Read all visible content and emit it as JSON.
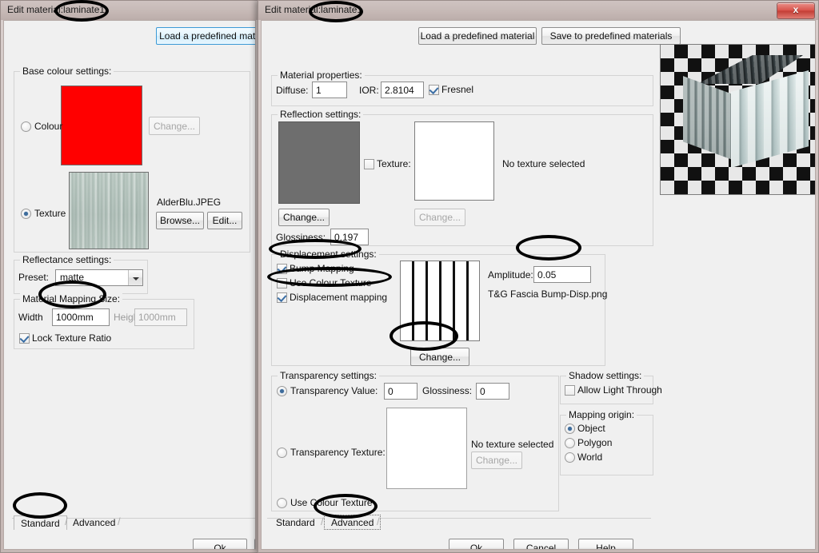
{
  "back_dialog": {
    "title_prefix": "Edit material:",
    "title_value": "laminate1",
    "load_button": "Load a predefined mate",
    "base_colour": {
      "group_title": "Base colour settings:",
      "colour_label": "Colour",
      "colour_swatch_hex": "#FF0000",
      "colour_change_button": "Change...",
      "texture_label": "Texture",
      "texture_filename": "AlderBlu.JPEG",
      "browse_button": "Browse...",
      "edit_button": "Edit..."
    },
    "reflectance": {
      "group_title": "Reflectance settings:",
      "preset_label": "Preset:",
      "preset_value": "matte"
    },
    "mapping": {
      "group_title": "Material Mapping Size:",
      "width_label": "Width",
      "width_value": "1000mm",
      "height_label": "Height",
      "height_value": "1000mm",
      "lock_label": "Lock Texture Ratio"
    },
    "tabs": {
      "standard": "Standard",
      "advanced": "Advanced"
    },
    "ok_button": "Ok"
  },
  "front_dialog": {
    "title_prefix": "Edit material:",
    "title_value": "laminate1",
    "close_glyph": "x",
    "load_button": "Load a predefined material",
    "save_button": "Save to predefined materials",
    "material_properties": {
      "group_title": "Material properties:",
      "diffuse_label": "Diffuse:",
      "diffuse_value": "1",
      "ior_label": "IOR:",
      "ior_value": "2.8104",
      "fresnel_label": "Fresnel"
    },
    "reflection": {
      "group_title": "Reflection settings:",
      "swatch_hex": "#6E6E6E",
      "change_button": "Change...",
      "texture_checkbox_label": "Texture:",
      "texture_change_button": "Change...",
      "no_texture_text": "No texture selected",
      "glossiness_label": "Glossiness:",
      "glossiness_value": "0.197"
    },
    "displacement": {
      "group_title": "Displacement settings:",
      "bump_mapping_label": "Bump Mapping",
      "use_colour_texture_label": "Use Colour Texture",
      "displacement_mapping_label": "Displacement mapping",
      "amplitude_label": "Amplitude:",
      "amplitude_value": "0.05",
      "map_filename": "T&G Fascia Bump-Disp.png",
      "change_button": "Change..."
    },
    "transparency": {
      "group_title": "Transparency settings:",
      "value_radio_label": "Transparency Value:",
      "value": "0",
      "glossiness_label": "Glossiness:",
      "glossiness_value": "0",
      "texture_radio_label": "Transparency Texture:",
      "no_texture_text": "No texture selected",
      "change_button": "Change...",
      "use_colour_texture_label": "Use Colour Texture"
    },
    "shadow": {
      "group_title": "Shadow settings:",
      "allow_light_label": "Allow Light Through"
    },
    "mapping_origin": {
      "group_title": "Mapping origin:",
      "options": [
        "Object",
        "Polygon",
        "World"
      ],
      "selected": "Object"
    },
    "tabs": {
      "standard": "Standard",
      "advanced": "Advanced"
    },
    "footer": {
      "ok": "Ok",
      "cancel": "Cancel",
      "help": "Help"
    }
  }
}
